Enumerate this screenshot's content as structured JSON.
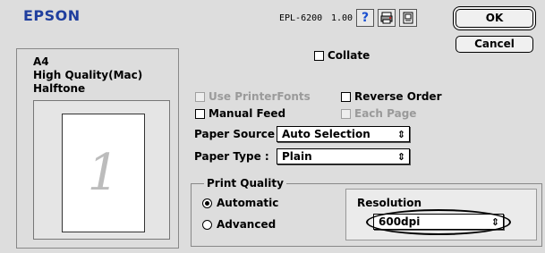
{
  "header": {
    "brand": "EPSON",
    "model": "EPL-6200",
    "version": "1.00"
  },
  "buttons": {
    "ok": "OK",
    "cancel": "Cancel"
  },
  "summary": {
    "paper": "A4",
    "quality": "High Quality(Mac)",
    "halftone": "Halftone"
  },
  "preview": {
    "page_number": "1"
  },
  "options": {
    "collate": "Collate",
    "use_printer_fonts": "Use PrinterFonts",
    "reverse_order": "Reverse Order",
    "manual_feed": "Manual Feed",
    "each_page": "Each Page"
  },
  "paper_source": {
    "label": "Paper Source :",
    "value": "Auto Selection"
  },
  "paper_type": {
    "label": "Paper Type :",
    "value": "Plain"
  },
  "print_quality": {
    "title": "Print Quality",
    "automatic": "Automatic",
    "advanced": "Advanced",
    "selected": "Automatic"
  },
  "resolution": {
    "label": "Resolution",
    "value": "600dpi"
  },
  "icons": {
    "help": "question-mark-icon",
    "settings": "printer-settings-icon",
    "layout": "page-layout-icon"
  },
  "colors": {
    "brand": "#1f3e9e",
    "help_icon": "#1a4fd0"
  }
}
